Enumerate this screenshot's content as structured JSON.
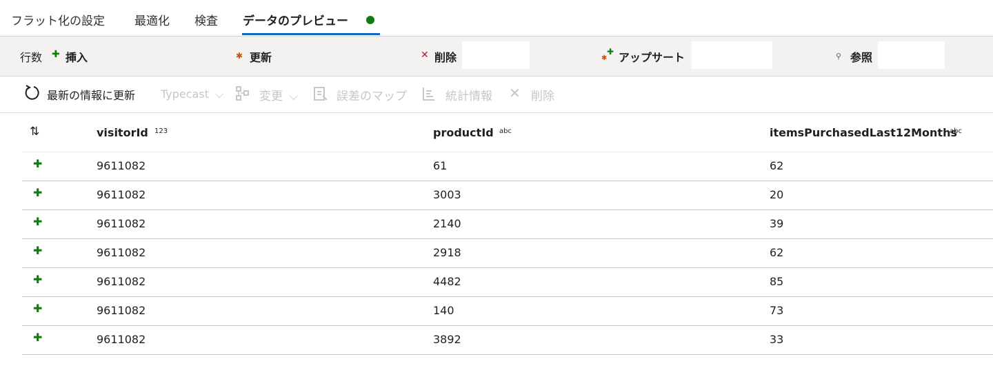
{
  "tabs": [
    {
      "label": "フラット化の設定"
    },
    {
      "label": "最適化"
    },
    {
      "label": "検査"
    },
    {
      "label": "データのプレビュー",
      "active": true
    }
  ],
  "summary": {
    "rows_label": "行数",
    "insert_label": "挿入",
    "update_label": "更新",
    "delete_label": "削除",
    "upsert_label": "アップサート",
    "lookup_label": "参照"
  },
  "toolbar": {
    "refresh_label": "最新の情報に更新",
    "typecast_label": "Typecast",
    "modify_label": "変更",
    "map_drifted_label": "誤差のマップ",
    "statistics_label": "統計情報",
    "remove_label": "削除"
  },
  "table": {
    "columns": [
      {
        "name": "visitorId",
        "type": "123"
      },
      {
        "name": "productId",
        "type": "abc"
      },
      {
        "name": "itemsPurchasedLast12Months",
        "type": "abc"
      }
    ],
    "rows": [
      [
        "9611082",
        "61",
        "62"
      ],
      [
        "9611082",
        "3003",
        "20"
      ],
      [
        "9611082",
        "2140",
        "39"
      ],
      [
        "9611082",
        "2918",
        "62"
      ],
      [
        "9611082",
        "4482",
        "85"
      ],
      [
        "9611082",
        "140",
        "73"
      ],
      [
        "9611082",
        "3892",
        "33"
      ]
    ]
  },
  "colors": {
    "accent": "#0f6cbd",
    "status_ok": "#107c10",
    "insert": "#107c10",
    "update": "#ca5010",
    "delete": "#a4262c"
  },
  "icons": {
    "status": "status-dot-icon",
    "insert": "plus-icon",
    "update": "asterisk-icon",
    "delete": "x-icon",
    "upsert": "upsert-icon",
    "lookup": "search-icon",
    "refresh": "refresh-icon",
    "sort": "sort-icon"
  }
}
